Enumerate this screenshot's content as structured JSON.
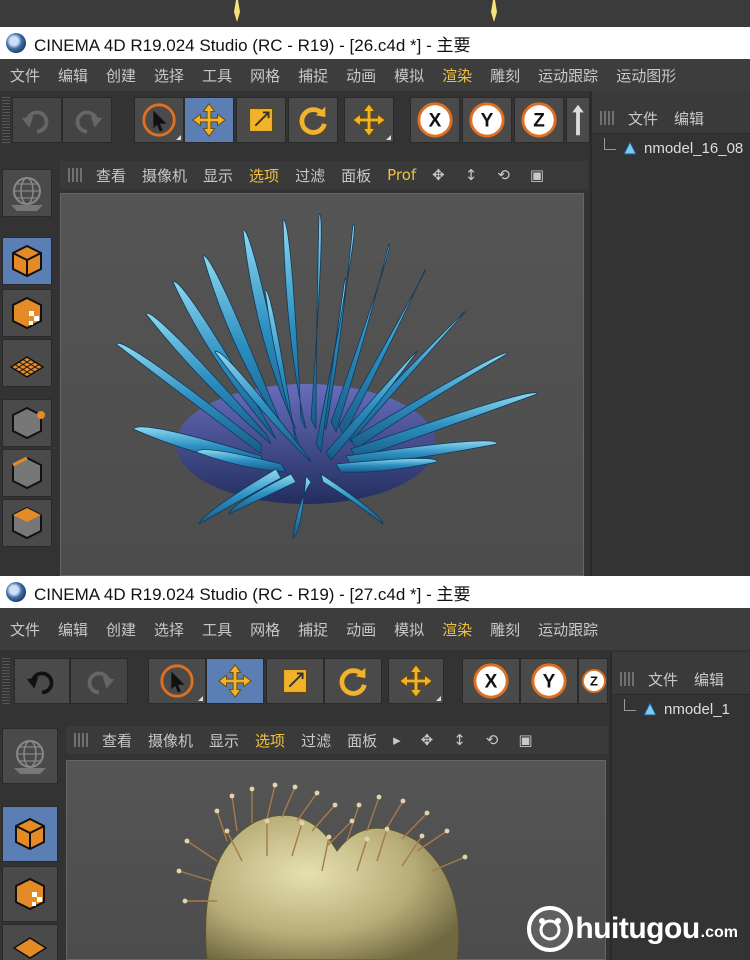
{
  "colors": {
    "accent_yellow": "#f0c040",
    "active_blue": "#5b7fb5",
    "viewport_gray": "#555555",
    "menu_text": "#c8c8c8"
  },
  "window1": {
    "title": "CINEMA 4D R19.024 Studio (RC - R19) - [26.c4d *] - 主要",
    "menu": [
      "文件",
      "编辑",
      "创建",
      "选择",
      "工具",
      "网格",
      "捕捉",
      "动画",
      "模拟",
      "渲染",
      "雕刻",
      "运动跟踪",
      "运动图形"
    ],
    "viewport_menu": [
      "查看",
      "摄像机",
      "显示",
      "选项",
      "过滤",
      "面板",
      "Prof"
    ],
    "right_panel_menu": [
      "文件",
      "编辑"
    ],
    "object": "nmodel_16_08"
  },
  "window2": {
    "title": "CINEMA 4D R19.024 Studio (RC - R19) - [27.c4d *] - 主要",
    "menu": [
      "文件",
      "编辑",
      "创建",
      "选择",
      "工具",
      "网格",
      "捕捉",
      "动画",
      "模拟",
      "渲染",
      "雕刻",
      "运动跟踪"
    ],
    "viewport_menu": [
      "查看",
      "摄像机",
      "显示",
      "选项",
      "过滤",
      "面板"
    ],
    "right_panel_menu": [
      "文件",
      "编辑"
    ],
    "object": "nmodel_1"
  },
  "toolbar_icons": [
    "undo-icon",
    "redo-icon",
    "select-arrow-icon",
    "move-icon",
    "scale-icon",
    "rotate-icon",
    "move-plus-icon",
    "x-axis-icon",
    "y-axis-icon",
    "z-axis-icon"
  ],
  "watermark": {
    "brand": "huitugou",
    "suffix": ".com"
  }
}
